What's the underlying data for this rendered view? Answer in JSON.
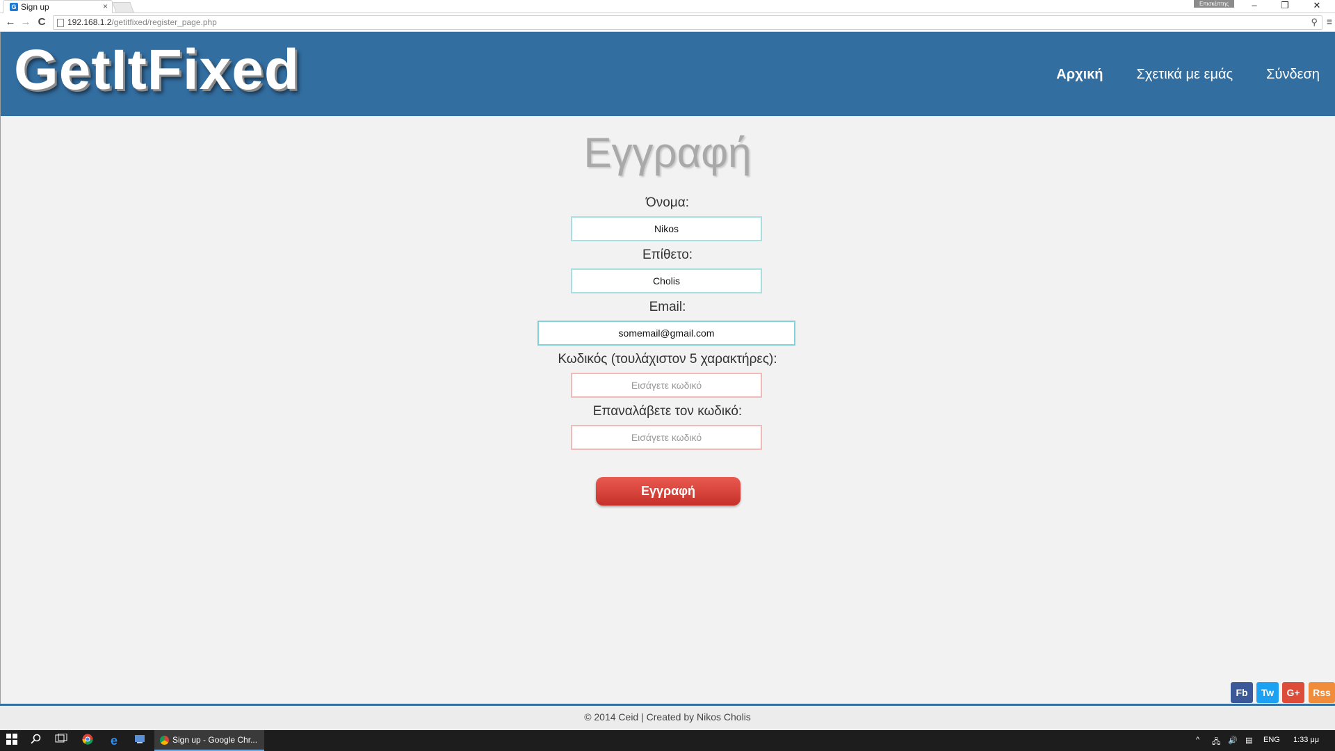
{
  "browser": {
    "tab_title": "Sign up",
    "tab_close": "×",
    "favicon_letter": "G",
    "url_host": "192.168.1.2",
    "url_path": "/getitfixed/register_page.php",
    "user_badge": "Επισκέπτης",
    "controls": {
      "back": "←",
      "forward": "→",
      "reload": "C",
      "zoom": "⚲",
      "menu": "≡",
      "minimize": "–",
      "restore": "❐",
      "close": "✕"
    }
  },
  "header": {
    "logo": "GetItFixed",
    "nav": [
      {
        "label": "Αρχική",
        "active": true
      },
      {
        "label": "Σχετικά με εμάς",
        "active": false
      },
      {
        "label": "Σύνδεση",
        "active": false
      }
    ]
  },
  "form": {
    "title": "Εγγραφή",
    "first_name": {
      "label": "Όνομα:",
      "value": "Nikos"
    },
    "last_name": {
      "label": "Επίθετο:",
      "value": "Cholis"
    },
    "email": {
      "label": "Email:",
      "value": "somemail@gmail.com"
    },
    "password": {
      "label": "Κωδικός (τουλάχιστον 5 χαρακτήρες):",
      "placeholder": "Εισάγετε κωδικό"
    },
    "password_repeat": {
      "label": "Επαναλάβετε τον κωδικό:",
      "placeholder": "Εισάγετε κωδικό"
    },
    "submit_label": "Εγγραφή"
  },
  "social": [
    {
      "label": "Fb",
      "color": "#3b5998"
    },
    {
      "label": "Tw",
      "color": "#1da1f2"
    },
    {
      "label": "G+",
      "color": "#dd4b39"
    },
    {
      "label": "Rss",
      "color": "#f08c3a"
    }
  ],
  "footer": {
    "text": "© 2014 Ceid | Created by Nikos Cholis"
  },
  "taskbar": {
    "active_task": "Sign up - Google Chr...",
    "language": "ENG",
    "time": "1:33 μμ"
  },
  "colors": {
    "header_bg": "#336ea1",
    "button_red": "#d9413a",
    "page_bg": "#f2f2f2"
  }
}
